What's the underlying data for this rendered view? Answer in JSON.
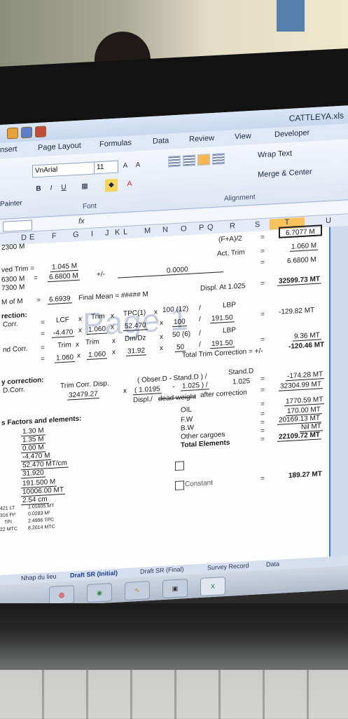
{
  "window": {
    "filename": "CATTLEYA.xls"
  },
  "ribbon": {
    "tabs": [
      "nsert",
      "Page Layout",
      "Formulas",
      "Data",
      "Review",
      "View",
      "Developer"
    ],
    "font_name": "VnArial",
    "font_size": "11",
    "painter_label": "Painter",
    "font_group_label": "Font",
    "alignment_group_label": "Alignment",
    "wrap_text_label": "Wrap Text",
    "merge_center_label": "Merge & Center"
  },
  "formula_bar": {
    "fx": "fx"
  },
  "columns": [
    "D",
    "E",
    "F",
    "G",
    "I",
    "J",
    "K",
    "L",
    "M",
    "N",
    "O",
    "P",
    "Q",
    "R",
    "S",
    "T",
    "U"
  ],
  "sheet": {
    "r0": {
      "left": "2300 M",
      "fa": "(F+A)/2",
      "eq": "=",
      "val": "6.7077 M"
    },
    "r1": {
      "left": "ved Trim =",
      "v": "1.045 M",
      "act": "Act. Trim",
      "eq": "=",
      "val": "1.060 M"
    },
    "r2": {
      "a": "6300 M",
      "eq1": "=",
      "b": "6.6800 M",
      "pm": "+/-",
      "c": "0.0000",
      "eq": "=",
      "val": "6.6800 M"
    },
    "r3": {
      "a": "7300 M"
    },
    "r4": {
      "left": "M of M",
      "eq1": "=",
      "a": "6.6939",
      "fm": "Final Mean = ##### M",
      "displ": "Displ. At 1.025",
      "eq": "=",
      "val": "32599.73 MT"
    },
    "r5": {
      "left": "rection:"
    },
    "r6": {
      "a": "Corr.",
      "eq": "=",
      "lcf": "LCF",
      "x1": "x",
      "trim": "Trim",
      "x2": "x",
      "tpc": "TPC(1)",
      "x3": "x",
      "h": "100 (12)",
      "sl": "/",
      "lbp": "LBP"
    },
    "r7": {
      "eq": "=",
      "a": "-4.470",
      "x1": "x",
      "b": "1.060",
      "x2": "x",
      "c": "52.470",
      "x3": "x",
      "d": "100",
      "sl": "/",
      "e": "191.50",
      "eq2": "=",
      "val": "-129.82 MT"
    },
    "r8": {
      "a": "nd Corr.",
      "eq": "=",
      "t1": "Trim",
      "x1": "x",
      "t2": "Trim",
      "x2": "x",
      "dm": "Dm/Dz",
      "x3": "x",
      "f": "50 (6)",
      "sl": "/",
      "lbp": "LBP"
    },
    "r9": {
      "eq": "=",
      "a": "1.060",
      "x1": "x",
      "b": "1.060",
      "x2": "x",
      "c": "31.92",
      "x3": "x",
      "d": "50",
      "sl": "/",
      "e": "191.50",
      "eq2": "=",
      "val": "9.36 MT"
    },
    "r10": {
      "ttc": "Total Trim Correction = +/-",
      "val": "-120.46 MT"
    },
    "r11": {
      "left": "y correction:"
    },
    "r12": {
      "a": "D.Corr.",
      "tcd": "Trim Corr. Disp.",
      "ob": "( Obser.D - Stand.D ) /",
      "sd": "Stand.D"
    },
    "r13": {
      "a": "32479.27",
      "x": "x",
      "b": "( 1.0195",
      "m": "-",
      "c": "1.025 ) /",
      "d": "1.025",
      "eq": "=",
      "val": "-174.28 MT"
    },
    "r14": {
      "dl": "Displ./",
      "dw": "dead weight",
      "ac": "after correction",
      "eq": "=",
      "val": "32304.99 MT"
    },
    "r15": {
      "left": "s Factors and elements:",
      "oil": "OIL",
      "eq": "=",
      "val": "1770.59 MT"
    },
    "r16": {
      "a": "1.30 M",
      "fw": "F.W",
      "eq": "=",
      "val": "170.00 MT"
    },
    "r17": {
      "a": "1.35 M",
      "bw": "B.W",
      "eq": "=",
      "val": "20169.13 MT"
    },
    "r18": {
      "a": "0.00 M",
      "oc": "Other cargoes",
      "eq": "=",
      "val": "Nil MT"
    },
    "r19": {
      "a": "-4.470 M",
      "te": "Total Elements",
      "eq": "=",
      "val": "22109.72 MT"
    },
    "r20": {
      "a": "52.470 MT/cm"
    },
    "r21": {
      "a": "31.920"
    },
    "r22": {
      "a": "191.500 M"
    },
    "r23": {
      "a": "10006.00 MT"
    },
    "r24": {
      "a": "2.54 cm",
      "cst": "Constant",
      "eq": "=",
      "val": "189.27 MT"
    },
    "r25": {
      "a": "421 LT",
      "b": "1.01605 MT"
    },
    "r26": {
      "a": "316 Ft³",
      "b": "0.0283 M³"
    },
    "r27": {
      "a": "TPI",
      "b": "2.4996 TPC"
    },
    "r28": {
      "a": "22 MTC",
      "b": "8.2014 MTC"
    },
    "watermark": "Page 1"
  },
  "sheet_tabs": [
    "Nhap du lieu",
    "Draft SR (Initial)",
    "Draft SR (Final)",
    "Survey Record",
    "Data"
  ]
}
